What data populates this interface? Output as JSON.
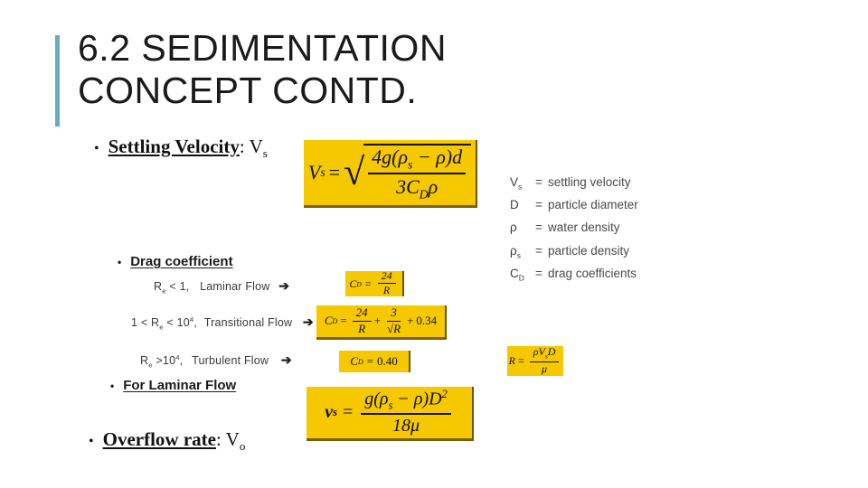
{
  "slide": {
    "title": "6.2 SEDIMENTATION\nCONCEPT CONTD.",
    "accent_color": "#63AFBC",
    "formula_box_color": "#F5C800",
    "background_color": "#FFFFFF"
  },
  "bullets": {
    "settling_velocity": {
      "marker": "•",
      "label": "Settling Velocity",
      "suffix": ": V",
      "suffix_sub": "s"
    },
    "drag_coefficient": {
      "marker": "•",
      "label": "Drag coefficient"
    },
    "for_laminar_flow": {
      "marker": "•",
      "label": "For Laminar Flow"
    },
    "overflow_rate": {
      "marker": "•",
      "label": "Overflow rate",
      "suffix": ": V",
      "suffix_sub": "o"
    }
  },
  "flow_conditions": [
    {
      "criterion_prefix": "R",
      "criterion_sub": "e",
      "criterion_rest": " < 1,",
      "name": "Laminar  Flow",
      "arrow": "➔"
    },
    {
      "criterion_prefix": "1 < R",
      "criterion_sub": "e",
      "criterion_rest": " < 10",
      "criterion_sup": "4",
      "criterion_tail": ",",
      "name": "Transitional  Flow",
      "arrow": "➔"
    },
    {
      "criterion_prefix": "R",
      "criterion_sub": "e",
      "criterion_rest": " >10",
      "criterion_sup": "4",
      "criterion_tail": ",",
      "name": "Turbulent Flow",
      "arrow": "➔"
    }
  ],
  "legend": {
    "rows": [
      {
        "symbol": "V",
        "symbol_sub": "s",
        "eq": "=",
        "definition": "settling velocity"
      },
      {
        "symbol": "D",
        "symbol_sub": "",
        "eq": "=",
        "definition": "particle diameter"
      },
      {
        "symbol": "ρ",
        "symbol_sub": "",
        "eq": "=",
        "definition": "water density"
      },
      {
        "symbol": "ρ",
        "symbol_sub": "s",
        "eq": "=",
        "definition": "particle density"
      },
      {
        "symbol": "C",
        "symbol_sub": "D",
        "eq": "=",
        "definition": "drag coefficients"
      }
    ]
  },
  "formulas": {
    "settling_velocity": {
      "lhs": "V",
      "lhs_sub": "s",
      "eq": "=",
      "radical": "√",
      "numerator": "4g(ρ",
      "numerator_sub": "s",
      "numerator_rest": " − ρ)d",
      "denominator": "3C",
      "denominator_sub": "D",
      "denominator_rest": "ρ",
      "plain": "Vs = sqrt( 4g(ρs − ρ)d / 3C_D ρ )"
    },
    "cd_laminar": {
      "lhs": "C",
      "lhs_sub": "D",
      "eq": "=",
      "numerator": "24",
      "denominator": "R",
      "plain": "C_D = 24/R"
    },
    "cd_transitional": {
      "lhs": "C",
      "lhs_sub": "D",
      "eq": "=",
      "term1_num": "24",
      "term1_den": "R",
      "plus1": "+",
      "term2_num": "3",
      "term2_den": "√R",
      "plus2": "+",
      "constant": "0.34",
      "plain": "C_D = 24/R + 3/√R + 0.34"
    },
    "cd_turbulent": {
      "lhs": "C",
      "lhs_sub": "D",
      "eq": "=",
      "value": "0.40",
      "plain": "C_D = 0.40"
    },
    "reynolds": {
      "lhs": "R",
      "eq": "=",
      "numerator": "ρV",
      "numerator_sub": "s",
      "numerator_rest": "D",
      "denominator": "μ",
      "plain": "R = ρVsD / μ"
    },
    "stokes": {
      "lhs": "v",
      "lhs_sub": "s",
      "eq": "=",
      "numerator": "g(ρ",
      "numerator_sub": "s",
      "numerator_rest": " − ρ)D",
      "numerator_sup": "2",
      "denominator": "18μ",
      "plain": "vs = g(ρs − ρ)D² / 18μ"
    }
  }
}
